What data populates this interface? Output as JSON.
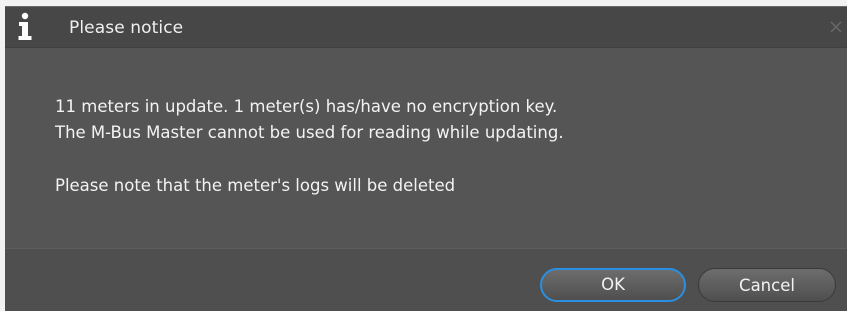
{
  "dialog": {
    "title": "Please notice",
    "title_icon": "info-icon",
    "close_icon": "close-icon",
    "message_lines": [
      "11 meters in update. 1 meter(s) has/have no encryption key.",
      "The M-Bus Master cannot be used for reading while updating.",
      "Please note that the meter's logs will be deleted"
    ],
    "buttons": {
      "ok_label": "OK",
      "cancel_label": "Cancel"
    },
    "colors": {
      "background": "#555555",
      "titlebar": "#474747",
      "focus_ring": "#2a8fe0",
      "text": "#f3f3f3"
    }
  }
}
